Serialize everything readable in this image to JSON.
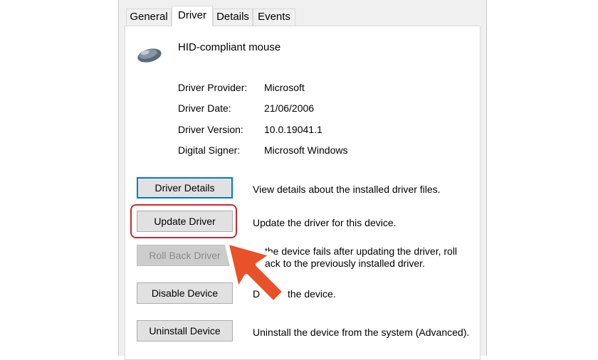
{
  "tabs": [
    "General",
    "Driver",
    "Details",
    "Events"
  ],
  "device": {
    "name": "HID-compliant mouse",
    "icon": "mouse-icon"
  },
  "info": [
    {
      "label": "Driver Provider:",
      "value": "Microsoft"
    },
    {
      "label": "Driver Date:",
      "value": "21/06/2006"
    },
    {
      "label": "Driver Version:",
      "value": "10.0.19041.1"
    },
    {
      "label": "Digital Signer:",
      "value": "Microsoft Windows"
    }
  ],
  "buttons": {
    "driver_details": {
      "label": "Driver Details",
      "desc": "View details about the installed driver files."
    },
    "update_driver": {
      "label": "Update Driver",
      "desc": "Update the driver for this device."
    },
    "roll_back": {
      "label": "Roll Back Driver",
      "desc_line1": "the device fails after updating the driver, roll",
      "desc_line2": "ack to the previously installed driver."
    },
    "disable_device": {
      "label": "Disable Device",
      "desc": "the device.",
      "desc_prefix": "D"
    },
    "uninstall_device": {
      "label": "Uninstall Device",
      "desc": "Uninstall the device from the system (Advanced)."
    }
  },
  "colors": {
    "highlight": "#c8282d",
    "arrow": "#e8512a",
    "focus": "#0078d7"
  }
}
